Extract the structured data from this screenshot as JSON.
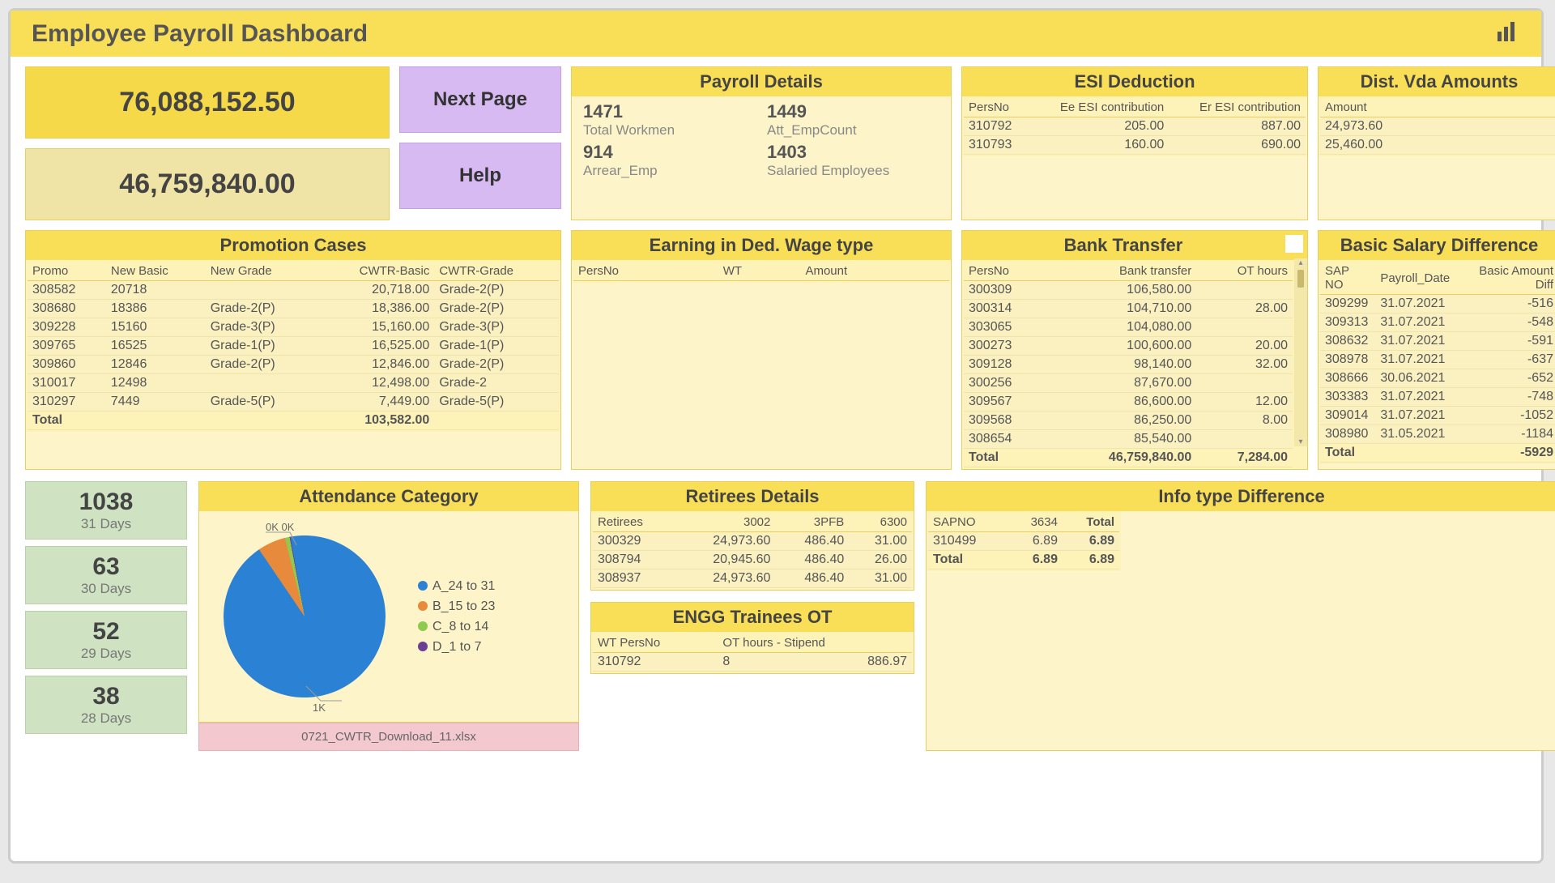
{
  "header": {
    "title": "Employee Payroll Dashboard"
  },
  "kpi": {
    "v1": "76,088,152.50",
    "v2": "46,759,840.00"
  },
  "buttons": {
    "next": "Next Page",
    "help": "Help"
  },
  "payroll_details": {
    "title": "Payroll Details",
    "c1v": "1471",
    "c1l": "Total Workmen",
    "c2v": "1449",
    "c2l": "Att_EmpCount",
    "c3v": "914",
    "c3l": "Arrear_Emp",
    "c4v": "1403",
    "c4l": "Salaried Employees"
  },
  "esi": {
    "title": "ESI Deduction",
    "headers": [
      "PersNo",
      "Ee ESI contribution",
      "Er ESI contribution"
    ],
    "rows": [
      [
        "310792",
        "205.00",
        "887.00"
      ],
      [
        "310793",
        "160.00",
        "690.00"
      ]
    ]
  },
  "vda": {
    "title": "Dist. Vda Amounts",
    "header": "Amount",
    "rows": [
      "24,973.60",
      "25,460.00"
    ]
  },
  "promo": {
    "title": "Promotion Cases",
    "headers": [
      "Promo",
      "New Basic",
      "New Grade",
      "CWTR-Basic",
      "CWTR-Grade"
    ],
    "rows": [
      [
        "308582",
        "20718",
        "",
        "20,718.00",
        "Grade-2(P)"
      ],
      [
        "308680",
        "18386",
        "Grade-2(P)",
        "18,386.00",
        "Grade-2(P)"
      ],
      [
        "309228",
        "15160",
        "Grade-3(P)",
        "15,160.00",
        "Grade-3(P)"
      ],
      [
        "309765",
        "16525",
        "Grade-1(P)",
        "16,525.00",
        "Grade-1(P)"
      ],
      [
        "309860",
        "12846",
        "Grade-2(P)",
        "12,846.00",
        "Grade-2(P)"
      ],
      [
        "310017",
        "12498",
        "",
        "12,498.00",
        "Grade-2"
      ],
      [
        "310297",
        "7449",
        "Grade-5(P)",
        "7,449.00",
        "Grade-5(P)"
      ]
    ],
    "total_label": "Total",
    "total_value": "103,582.00"
  },
  "earning": {
    "title": "Earning in Ded. Wage type",
    "headers": [
      "PersNo",
      "WT",
      "Amount"
    ]
  },
  "bank": {
    "title": "Bank Transfer",
    "headers": [
      "PersNo",
      "Bank transfer",
      "OT hours"
    ],
    "rows": [
      [
        "300309",
        "106,580.00",
        ""
      ],
      [
        "300314",
        "104,710.00",
        "28.00"
      ],
      [
        "303065",
        "104,080.00",
        ""
      ],
      [
        "300273",
        "100,600.00",
        "20.00"
      ],
      [
        "309128",
        "98,140.00",
        "32.00"
      ],
      [
        "300256",
        "87,670.00",
        ""
      ],
      [
        "309567",
        "86,600.00",
        "12.00"
      ],
      [
        "309568",
        "86,250.00",
        "8.00"
      ],
      [
        "308654",
        "85,540.00",
        ""
      ]
    ],
    "total_label": "Total",
    "total_v1": "46,759,840.00",
    "total_v2": "7,284.00"
  },
  "basic_diff": {
    "title": "Basic Salary Difference",
    "headers": [
      "SAP NO",
      "Payroll_Date",
      "Basic Amount Diff"
    ],
    "rows": [
      [
        "309299",
        "31.07.2021",
        "-516"
      ],
      [
        "309313",
        "31.07.2021",
        "-548"
      ],
      [
        "308632",
        "31.07.2021",
        "-591"
      ],
      [
        "308978",
        "31.07.2021",
        "-637"
      ],
      [
        "308666",
        "30.06.2021",
        "-652"
      ],
      [
        "303383",
        "31.07.2021",
        "-748"
      ],
      [
        "309014",
        "31.07.2021",
        "-1052"
      ],
      [
        "308980",
        "31.05.2021",
        "-1184"
      ]
    ],
    "total_label": "Total",
    "total_value": "-5929"
  },
  "days": [
    {
      "n": "1038",
      "l": "31 Days"
    },
    {
      "n": "63",
      "l": "30 Days"
    },
    {
      "n": "52",
      "l": "29 Days"
    },
    {
      "n": "38",
      "l": "28 Days"
    }
  ],
  "attendance": {
    "title": "Attendance Category",
    "legend": [
      {
        "label": "A_24 to 31",
        "color": "#2b82d4"
      },
      {
        "label": "B_15 to 23",
        "color": "#e78a3b"
      },
      {
        "label": "C_8 to 14",
        "color": "#8fc94d"
      },
      {
        "label": "D_1 to 7",
        "color": "#6b3f91"
      }
    ],
    "annot_top": "0K 0K",
    "annot_bottom": "1K",
    "file": "0721_CWTR_Download_11.xlsx"
  },
  "chart_data": {
    "type": "pie",
    "title": "Attendance Category",
    "series": [
      {
        "name": "A_24 to 31",
        "value": 1000,
        "color": "#2b82d4"
      },
      {
        "name": "B_15 to 23",
        "value": 60,
        "color": "#e78a3b"
      },
      {
        "name": "C_8 to 14",
        "value": 10,
        "color": "#8fc94d"
      },
      {
        "name": "D_1 to 7",
        "value": 2,
        "color": "#6b3f91"
      }
    ]
  },
  "retirees": {
    "title": "Retirees Details",
    "headers": [
      "Retirees",
      "3002",
      "3PFB",
      "6300"
    ],
    "rows": [
      [
        "300329",
        "24,973.60",
        "486.40",
        "31.00"
      ],
      [
        "308794",
        "20,945.60",
        "486.40",
        "26.00"
      ],
      [
        "308937",
        "24,973.60",
        "486.40",
        "31.00"
      ]
    ]
  },
  "engg": {
    "title": "ENGG Trainees OT",
    "h1": "WT PersNo",
    "h2": "OT hours - Stipend",
    "h2b": ". .",
    "rows": [
      [
        "310792",
        "8",
        "886.97"
      ]
    ]
  },
  "info_diff": {
    "title": "Info type Difference",
    "headers": [
      "SAPNO",
      "3634",
      "Total"
    ],
    "rows": [
      [
        "310499",
        "6.89",
        "6.89"
      ]
    ],
    "total_label": "Total",
    "total_v1": "6.89",
    "total_v2": "6.89"
  }
}
